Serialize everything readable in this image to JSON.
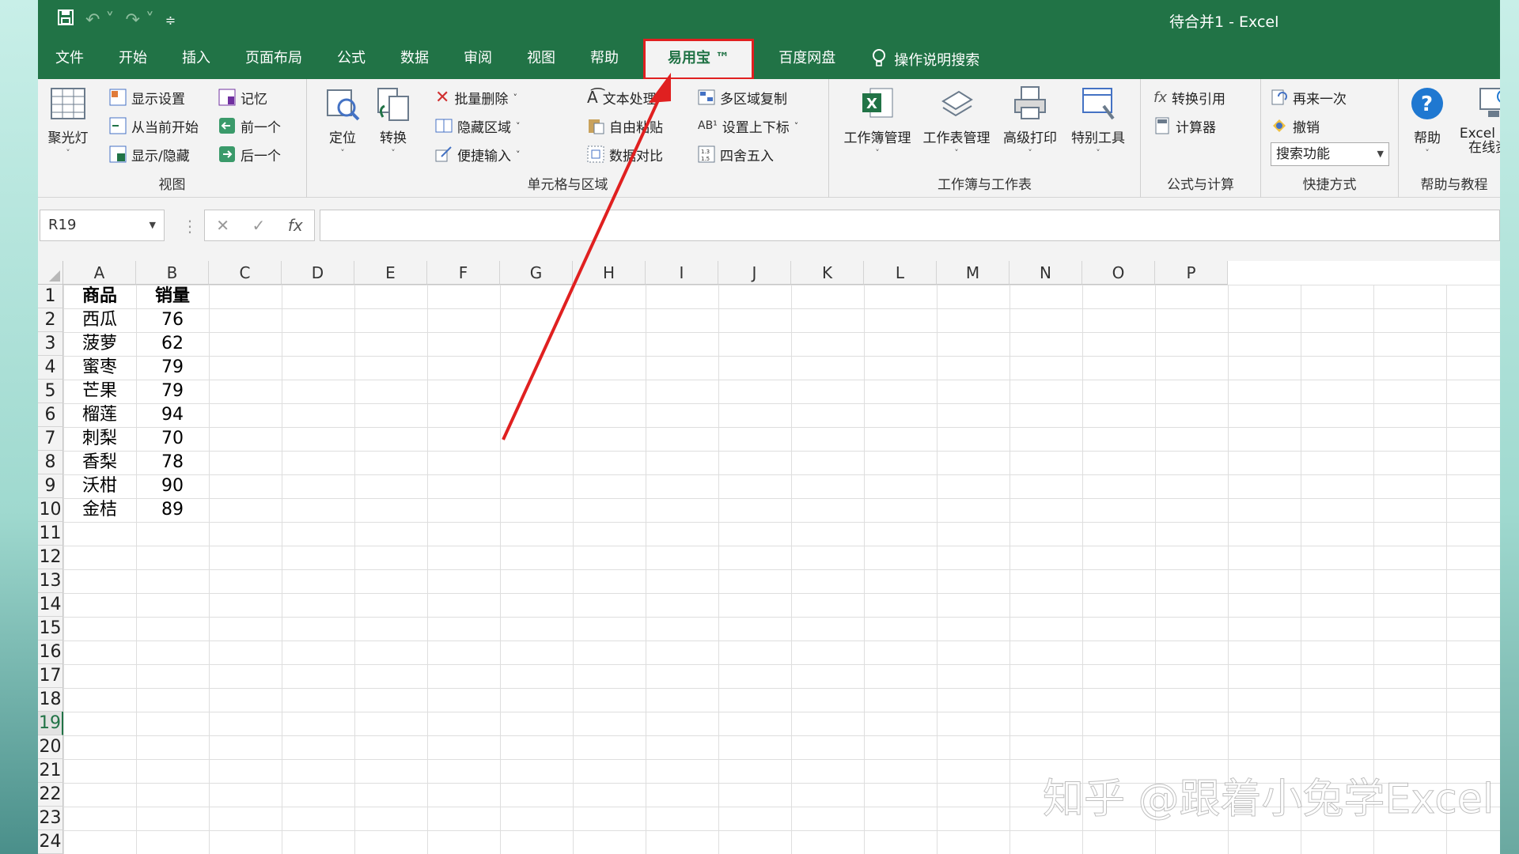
{
  "title": "待合并1  -  Excel",
  "tabs": [
    "文件",
    "开始",
    "插入",
    "页面布局",
    "公式",
    "数据",
    "审阅",
    "视图",
    "帮助",
    "易用宝 ™",
    "百度网盘"
  ],
  "tab_search": "操作说明搜索",
  "ribbon": {
    "view": {
      "label": "视图",
      "spotlight": "聚光灯",
      "display_settings": "显示设置",
      "start_from_current": "从当前开始",
      "show_hide": "显示/隐藏",
      "memory": "记忆",
      "prev": "前一个",
      "next": "后一个"
    },
    "cells": {
      "label": "单元格与区域",
      "locate": "定位",
      "convert": "转换",
      "batch_delete": "批量删除",
      "hide_area": "隐藏区域",
      "quick_input": "便捷输入",
      "text_process": "文本处理",
      "free_paste": "自由粘贴",
      "data_compare": "数据对比",
      "multi_copy": "多区域复制",
      "sub_super": "设置上下标",
      "round": "四舍五入"
    },
    "workbook": {
      "label": "工作簿与工作表",
      "workbook_mgmt": "工作簿管理",
      "sheet_mgmt": "工作表管理",
      "adv_print": "高级打印",
      "special_tools": "特别工具"
    },
    "formula": {
      "label": "公式与计算",
      "convert_ref": "转换引用",
      "calculator": "计算器"
    },
    "shortcut": {
      "label": "快捷方式",
      "repeat": "再来一次",
      "undo": "撤销",
      "search_func": "搜索功能"
    },
    "help": {
      "label": "帮助与教程",
      "help": "帮助",
      "excel_home": "Excel Hom",
      "online": "在线资源"
    }
  },
  "formula_bar": {
    "name_box": "R19",
    "fx": "fx"
  },
  "columns": [
    "A",
    "B",
    "C",
    "D",
    "E",
    "F",
    "G",
    "H",
    "I",
    "J",
    "K",
    "L",
    "M",
    "N",
    "O",
    "P"
  ],
  "rows": [
    "1",
    "2",
    "3",
    "4",
    "5",
    "6",
    "7",
    "8",
    "9",
    "10",
    "11",
    "12",
    "13",
    "14",
    "15",
    "16",
    "17",
    "18",
    "19",
    "20",
    "21",
    "22",
    "23",
    "24"
  ],
  "table": {
    "headers": [
      "商品",
      "销量"
    ],
    "rows": [
      [
        "西瓜",
        "76"
      ],
      [
        "菠萝",
        "62"
      ],
      [
        "蜜枣",
        "79"
      ],
      [
        "芒果",
        "79"
      ],
      [
        "榴莲",
        "94"
      ],
      [
        "刺梨",
        "70"
      ],
      [
        "香梨",
        "78"
      ],
      [
        "沃柑",
        "90"
      ],
      [
        "金桔",
        "89"
      ]
    ]
  },
  "watermark": "知乎 @跟着小兔学Excel",
  "colors": {
    "excel_green": "#217346",
    "highlight_red": "#e02020"
  }
}
